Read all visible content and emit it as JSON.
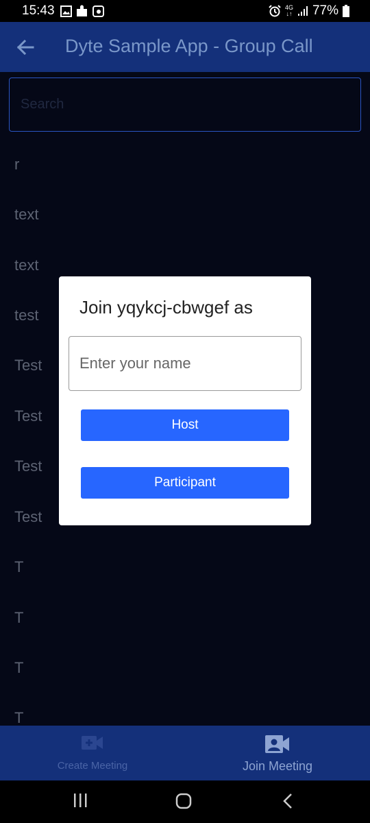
{
  "status_bar": {
    "time": "15:43",
    "network": "4G",
    "battery": "77%"
  },
  "app_bar": {
    "title": "Dyte Sample App - Group Call"
  },
  "search": {
    "placeholder": "Search"
  },
  "list": {
    "items": [
      "r",
      "text",
      "text",
      "test",
      "Test",
      "Test",
      "Test",
      "Test",
      "T",
      "T",
      "T",
      "T"
    ]
  },
  "dialog": {
    "title": "Join yqykcj-cbwgef as",
    "name_placeholder": "Enter your name",
    "host_label": "Host",
    "participant_label": "Participant"
  },
  "bottom_nav": {
    "create_label": "Create Meeting",
    "join_label": "Join Meeting"
  },
  "colors": {
    "app_bar": "#14307a",
    "background": "#050817",
    "button": "#2766ff",
    "dialog": "#ffffff"
  },
  "icons": {
    "back": "arrow-left-icon",
    "create": "video-add-icon",
    "join": "person-video-icon",
    "recents": "recents-icon",
    "home": "home-icon",
    "nav_back": "chevron-left-icon"
  }
}
